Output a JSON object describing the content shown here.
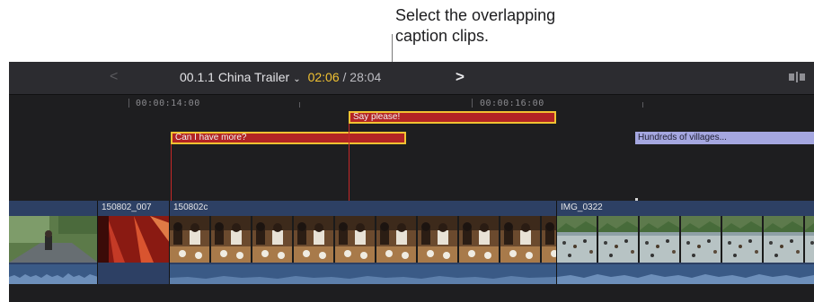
{
  "callout": {
    "line1": "Select the overlapping",
    "line2": "caption clips."
  },
  "toolbar": {
    "back_icon": "<",
    "project_name": "00.1.1 China Trailer",
    "project_chevron": "⌄",
    "current_timecode": "02:06",
    "separator": " / ",
    "total_duration": "28:04",
    "forward_icon": ">"
  },
  "ruler": {
    "timecodes": [
      "00:00:14:00",
      "00:00:16:00"
    ]
  },
  "captions": [
    {
      "text": "Say please!",
      "selected": true
    },
    {
      "text": "Can I have more?",
      "selected": true
    },
    {
      "text": "Hundreds of villages...",
      "selected": false
    }
  ],
  "clips": [
    {
      "label": ""
    },
    {
      "label": "150802_007"
    },
    {
      "label": "150802c"
    },
    {
      "label": "IMG_0322"
    }
  ],
  "colors": {
    "caption_selected_fill": "#b32424",
    "selection_outline": "#f1c232",
    "caption_unselected_fill": "#a5a7e0",
    "clip_background": "#2d4064",
    "timecode_accent": "#f1c232"
  }
}
